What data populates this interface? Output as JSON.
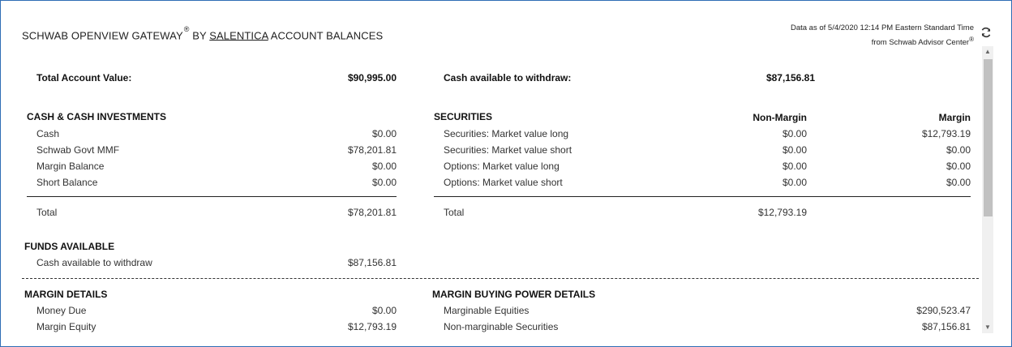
{
  "header": {
    "title_main": "SCHWAB OPENVIEW GATEWAY",
    "registered": "®",
    "title_by": "BY",
    "title_link": "SALENTICA",
    "title_suffix": "ACCOUNT BALANCES",
    "as_of_line1": "Data as of 5/4/2020 12:14 PM Eastern Standard Time",
    "as_of_line2": "from Schwab Advisor Center",
    "as_of_mark": "®",
    "refresh_icon": "refresh-icon"
  },
  "summary": {
    "total_label": "Total Account Value:",
    "total_value": "$90,995.00",
    "cash_label": "Cash available to withdraw:",
    "cash_value": "$87,156.81"
  },
  "cash": {
    "heading": "CASH & CASH INVESTMENTS",
    "rows": [
      {
        "label": "Cash",
        "value": "$0.00"
      },
      {
        "label": "Schwab Govt MMF",
        "value": "$78,201.81"
      },
      {
        "label": "Margin Balance",
        "value": "$0.00"
      },
      {
        "label": "Short Balance",
        "value": "$0.00"
      }
    ],
    "total_label": "Total",
    "total_value": "$78,201.81"
  },
  "securities": {
    "heading": "SECURITIES",
    "col_nonmargin": "Non-Margin",
    "col_margin": "Margin",
    "rows": [
      {
        "label": "Securities: Market value long",
        "nonmargin": "$0.00",
        "margin": "$12,793.19"
      },
      {
        "label": "Securities: Market value short",
        "nonmargin": "$0.00",
        "margin": "$0.00"
      },
      {
        "label": "Options: Market value long",
        "nonmargin": "$0.00",
        "margin": "$0.00"
      },
      {
        "label": "Options: Market value short",
        "nonmargin": "$0.00",
        "margin": "$0.00"
      }
    ],
    "total_label": "Total",
    "total_value": "$12,793.19"
  },
  "funds": {
    "heading": "FUNDS AVAILABLE",
    "row_label": "Cash available to withdraw",
    "row_value": "$87,156.81"
  },
  "margin": {
    "heading": "MARGIN DETAILS",
    "rows": [
      {
        "label": "Money Due",
        "value": "$0.00"
      },
      {
        "label": "Margin Equity",
        "value": "$12,793.19"
      }
    ]
  },
  "buying_power": {
    "heading": "MARGIN BUYING POWER DETAILS",
    "rows": [
      {
        "label": "Marginable Equities",
        "value": "$290,523.47"
      },
      {
        "label": "Non-marginable Securities",
        "value": "$87,156.81"
      }
    ]
  },
  "colors": {
    "border": "#2f6db5",
    "scroll_track": "#f0f0f0",
    "scroll_thumb": "#c1c1c1"
  }
}
